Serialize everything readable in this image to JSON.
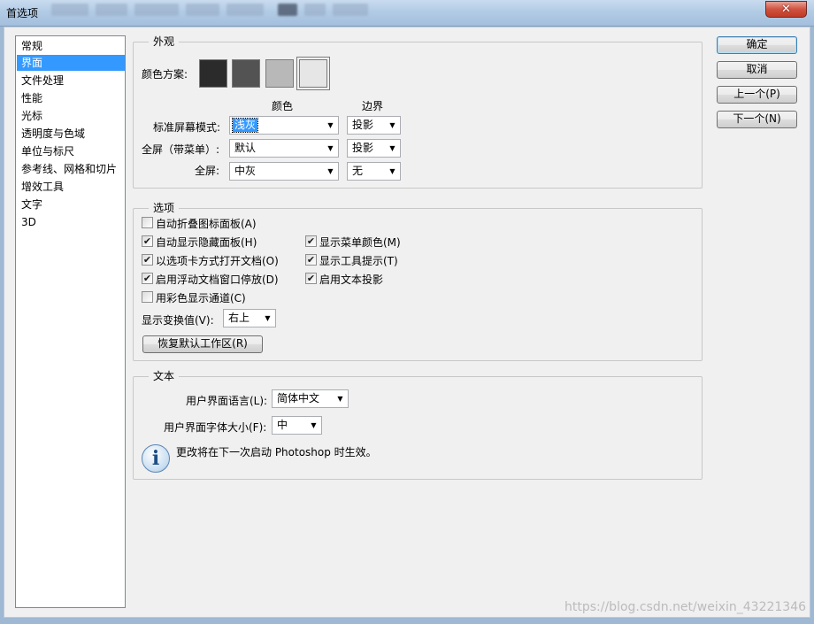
{
  "window": {
    "title": "首选项",
    "close_glyph": "✕"
  },
  "nav": {
    "items": [
      "常规",
      "界面",
      "文件处理",
      "性能",
      "光标",
      "透明度与色域",
      "单位与标尺",
      "参考线、网格和切片",
      "增效工具",
      "文字",
      "3D"
    ],
    "selected": "界面"
  },
  "appearance": {
    "group_title": "外观",
    "color_scheme_label": "颜色方案:",
    "color_swatches": [
      "#2b2b2b",
      "#535353",
      "#b8b8b8",
      "#e6e6e6"
    ],
    "header_color": "颜色",
    "header_border": "边界",
    "rows": [
      {
        "label": "标准屏幕模式:",
        "color": "浅灰",
        "border": "投影"
      },
      {
        "label": "全屏（带菜单）:",
        "color": "默认",
        "border": "投影"
      },
      {
        "label": "全屏:",
        "color": "中灰",
        "border": "无"
      }
    ]
  },
  "options": {
    "group_title": "选项",
    "checkboxes": [
      {
        "label": "自动折叠图标面板(A)",
        "checked": false
      },
      {
        "label": "自动显示隐藏面板(H)",
        "checked": true
      },
      {
        "label": "以选项卡方式打开文档(O)",
        "checked": true
      },
      {
        "label": "启用浮动文档窗口停放(D)",
        "checked": true
      },
      {
        "label": "用彩色显示通道(C)",
        "checked": false
      },
      {
        "label": "显示菜单颜色(M)",
        "checked": true
      },
      {
        "label": "显示工具提示(T)",
        "checked": true
      },
      {
        "label": "启用文本投影",
        "checked": true
      }
    ],
    "transform_label": "显示变换值(V):",
    "transform_value": "右上",
    "restore_button": "恢复默认工作区(R)"
  },
  "text": {
    "group_title": "文本",
    "ui_language_label": "用户界面语言(L):",
    "ui_language_value": "简体中文",
    "ui_font_size_label": "用户界面字体大小(F):",
    "ui_font_size_value": "中",
    "info_note": "更改将在下一次启动 Photoshop 时生效。"
  },
  "buttons": {
    "ok": "确定",
    "cancel": "取消",
    "prev": "上一个(P)",
    "next": "下一个(N)"
  },
  "check_glyph": "✔",
  "arrow_glyph": "▼",
  "info_glyph": "i",
  "watermark": "https://blog.csdn.net/weixin_43221346"
}
